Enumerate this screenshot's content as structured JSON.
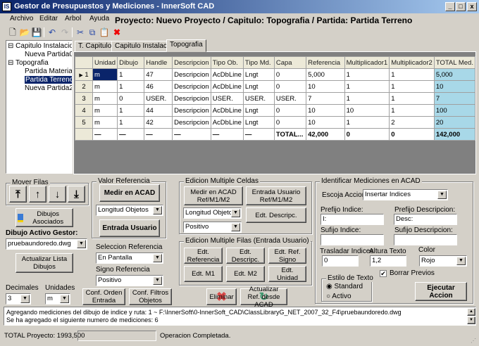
{
  "window": {
    "title": "Gestor de Presupuestos y Mediciones - InnerSoft CAD",
    "icon": "IS",
    "min": "_",
    "max": "□",
    "close": "x"
  },
  "menu": [
    "Archivo",
    "Editar",
    "Arbol",
    "Ayuda"
  ],
  "heading": "Proyecto: Nuevo Proyecto / Capitulo: Topografia / Partida: Partida Terreno",
  "toolbar": [
    "new-file-icon",
    "open-folder-icon",
    "save-icon",
    "undo-icon",
    "redo-icon",
    "cut-icon",
    "copy-icon",
    "paste-icon",
    "delete-icon"
  ],
  "tree": [
    {
      "label": "Capitulo Instalacion",
      "toggle": "⊟",
      "level": 0
    },
    {
      "label": "Nueva Partida0",
      "level": 1
    },
    {
      "label": "Topografia",
      "toggle": "⊟",
      "level": 0
    },
    {
      "label": "Partida Material",
      "level": 1
    },
    {
      "label": "Partida Terreno",
      "level": 1,
      "selected": true
    },
    {
      "label": "Nueva Partida2",
      "level": 1
    }
  ],
  "tabs": [
    "T. Capitulos",
    "Capitulo Instalacion",
    "Topografia"
  ],
  "grid": {
    "columns": [
      "Unidad",
      "Dibujo",
      "Handle",
      "Descripcion",
      "Tipo Ob.",
      "Tipo Md.",
      "Capa",
      "Referencia",
      "Multiplicador1",
      "Multiplicador2",
      "TOTAL Med."
    ],
    "rows": [
      {
        "n": "1",
        "cells": [
          "m",
          "1",
          "47",
          "Descripcion",
          "AcDbLine",
          "Lngt",
          "0",
          "5,000",
          "1",
          "1",
          "5,000"
        ]
      },
      {
        "n": "2",
        "cells": [
          "m",
          "1",
          "46",
          "Descripcion",
          "AcDbLine",
          "Lngt",
          "0",
          "10",
          "1",
          "1",
          "10"
        ]
      },
      {
        "n": "3",
        "cells": [
          "m",
          "0",
          "USER.",
          "Descripcion",
          "USER.",
          "USER.",
          "USER.",
          "7",
          "1",
          "1",
          "7"
        ]
      },
      {
        "n": "4",
        "cells": [
          "m",
          "1",
          "44",
          "Descripcion",
          "AcDbLine",
          "Lngt",
          "0",
          "10",
          "10",
          "1",
          "100"
        ]
      },
      {
        "n": "5",
        "cells": [
          "m",
          "1",
          "42",
          "Descripcion",
          "AcDbLine",
          "Lngt",
          "0",
          "10",
          "1",
          "2",
          "20"
        ]
      }
    ],
    "total": [
      "—",
      "—",
      "—",
      "—",
      "—",
      "—",
      "TOTAL...",
      "42,000",
      "0",
      "0",
      "142,000"
    ],
    "current_row_marker": "▶"
  },
  "mover": {
    "title": "Mover Filas",
    "buttons": [
      "⤒",
      "↑",
      "↓",
      "⤓"
    ]
  },
  "dibujos_asociados": "Dibujos Asociados",
  "dibujo_activo": {
    "label": "Dibujo Activo Gestor:",
    "value": "pruebaundoredo.dwg"
  },
  "actualizar_lista": "Actualizar Lista Dibujos",
  "decimales": {
    "label": "Decimales",
    "value": "3"
  },
  "unidades": {
    "label": "Unidades",
    "value": "m"
  },
  "valor_ref": {
    "title": "Valor Referencia",
    "medir": "Medir en ACAD",
    "tipo": "Longitud Objetos",
    "entrada": "Entrada Usuario"
  },
  "seleccion_ref": {
    "label": "Seleccion Referencia",
    "value": "En Pantalla"
  },
  "signo_ref": {
    "label": "Signo Referencia",
    "value": "Positivo"
  },
  "conf_orden": "Conf. Orden Entrada",
  "conf_filtros": "Conf. Filtros Objetos",
  "multi_celdas": {
    "title": "Edicion Multiple Celdas",
    "medir": "Medir en ACAD Ref/M1/M2",
    "entrada": "Entrada Usuario Ref/M1/M2",
    "tipo": "Longitud Objetos",
    "signo": "Positivo",
    "edt_desc": "Edt. Descripc."
  },
  "multi_filas": {
    "title": "Edicion Multiple Filas (Entrada Usuario)",
    "buttons": [
      "Edt. Referencia",
      "Edt. Descripc.",
      "Edt. Ref. Signo",
      "Edt. M1",
      "Edt. M2",
      "Edt. Unidad"
    ]
  },
  "eliminar": "Eliminar",
  "actualizar_ref": "Actualizar Ref. desde ACAD",
  "identificar": {
    "title": "Identificar Mediciones en ACAD",
    "accion_label": "Escoja Accion",
    "accion": "Insertar Indices",
    "prefijo_indice_label": "Prefijo Indice:",
    "prefijo_indice": "I:",
    "prefijo_desc_label": "Prefijo Descripcion:",
    "prefijo_desc": "Desc:",
    "sufijo_indice_label": "Sufijo Indice:",
    "sufijo_indice": "",
    "sufijo_desc_label": "Sufijo Descripcion:",
    "sufijo_desc": "",
    "trasladar_label": "Trasladar Indices",
    "trasladar": "0",
    "altura_label": "Altura Texto",
    "altura": "1,2",
    "color_label": "Color",
    "color": "Rojo",
    "borrar_label": "Borrar Previos",
    "borrar_checked": true,
    "estilo_title": "Estilo de Texto",
    "estilo_options": [
      "Standard",
      "Activo"
    ],
    "estilo_selected": "Standard",
    "ejecutar": "Ejecutar Accion"
  },
  "log": [
    "Agregando mediciones del dibujo de indice y ruta: 1 ~ F:\\InnerSoft\\0-InnerSoft_CAD\\ClassLibraryG_NET_2007_32_F4\\pruebaundoredo.dwg",
    "Se ha agregado el siguiente numero de mediciones: 6"
  ],
  "status": {
    "total": "TOTAL Proyecto: 1993,500",
    "message": "Operacion Completada."
  }
}
